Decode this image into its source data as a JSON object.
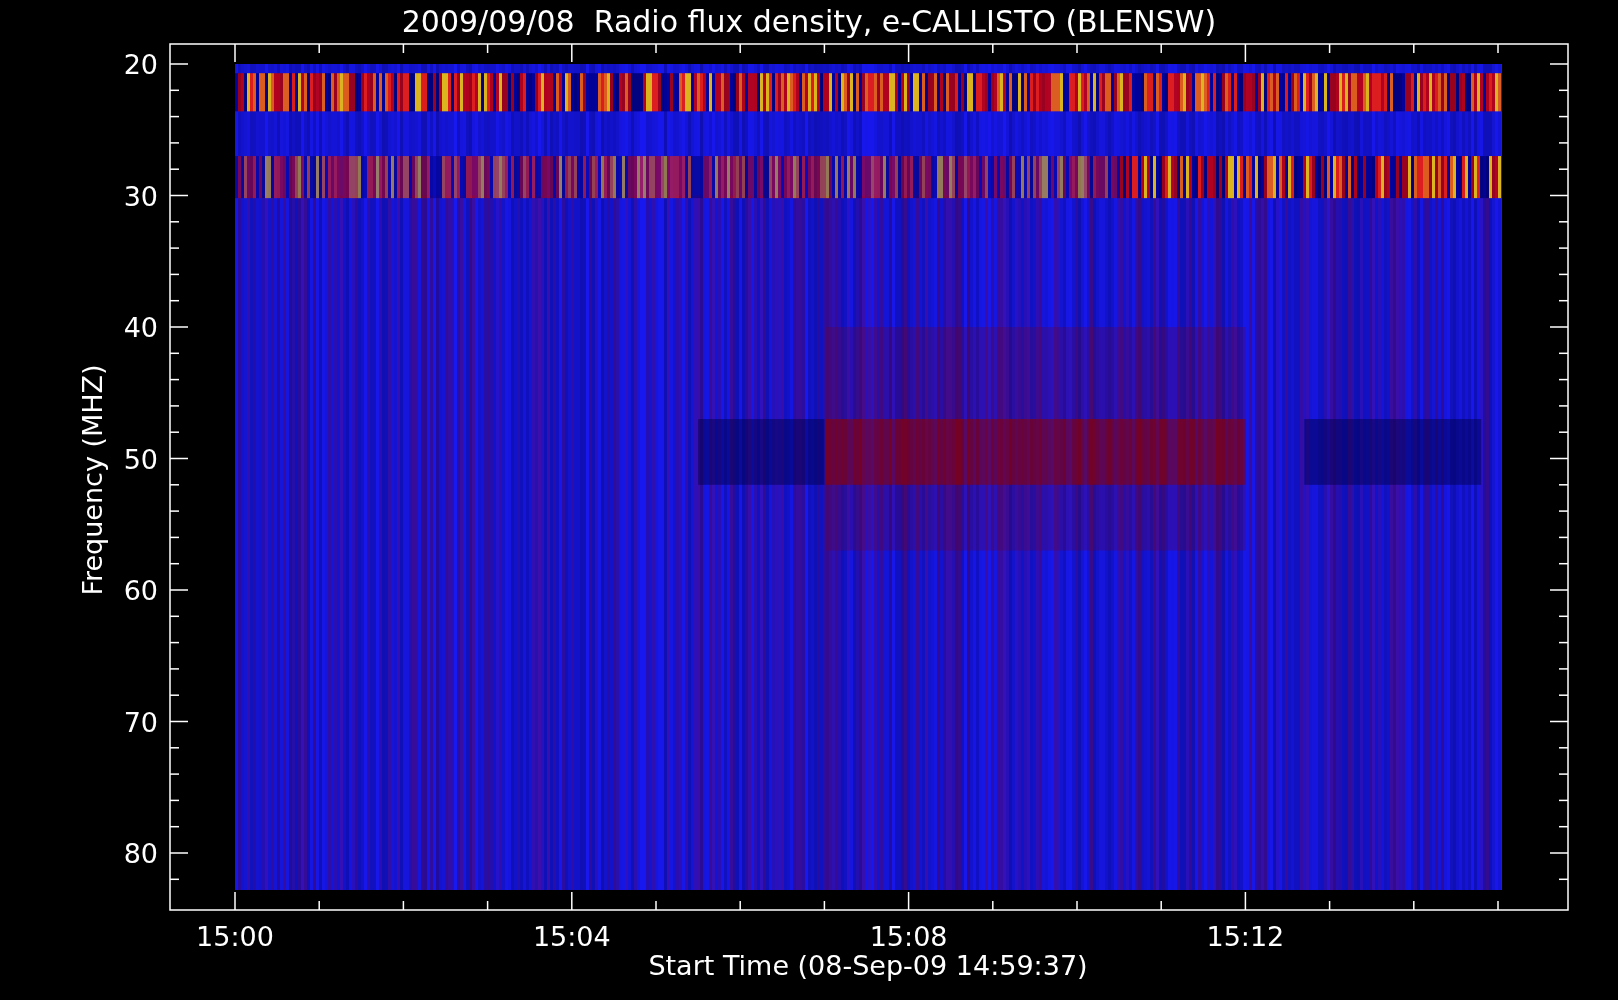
{
  "title": "2009/09/08  Radio flux density, e-CALLISTO (BLENSW)",
  "y_axis": {
    "label": "Frequency (MHZ)",
    "ticks": [
      "20",
      "30",
      "40",
      "50",
      "60",
      "70",
      "80"
    ]
  },
  "x_axis": {
    "label": "Start Time (08-Sep-09 14:59:37)",
    "ticks": [
      "15:00",
      "15:04",
      "15:08",
      "15:12"
    ]
  }
}
